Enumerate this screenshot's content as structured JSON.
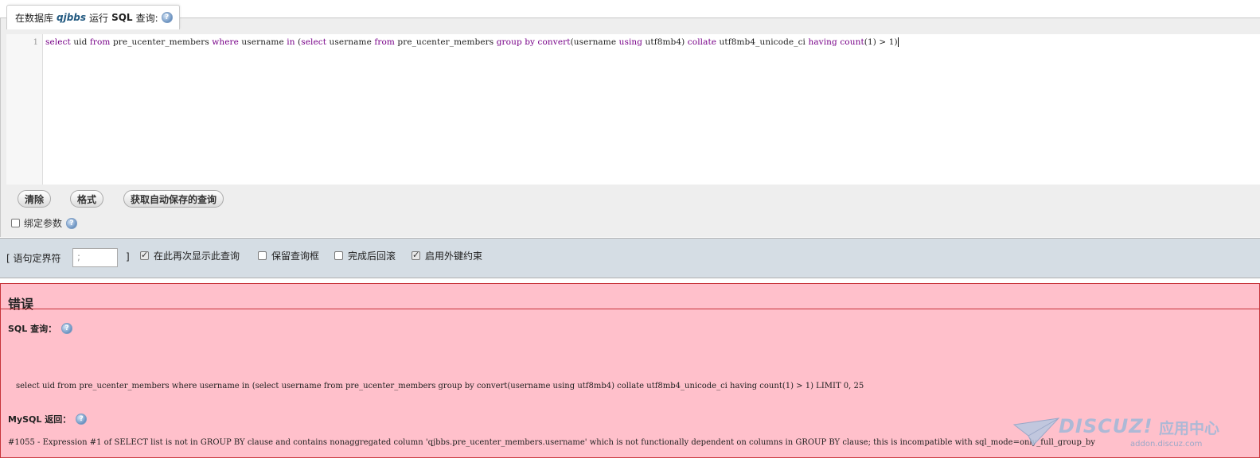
{
  "query_box": {
    "legend_prefix": "在数据库",
    "db_name": "qjbbs",
    "legend_run": "运行",
    "legend_sql": "SQL",
    "legend_suffix": "查询:",
    "help_glyph": "?",
    "line_number": "1",
    "code_tokens": [
      {
        "t": "select",
        "kw": true
      },
      {
        "t": " uid ",
        "kw": false
      },
      {
        "t": "from",
        "kw": true
      },
      {
        "t": " pre_ucenter_members ",
        "kw": false
      },
      {
        "t": "where",
        "kw": true
      },
      {
        "t": " username ",
        "kw": false
      },
      {
        "t": "in",
        "kw": true
      },
      {
        "t": " (",
        "kw": false
      },
      {
        "t": "select",
        "kw": true
      },
      {
        "t": " username ",
        "kw": false
      },
      {
        "t": "from",
        "kw": true
      },
      {
        "t": " pre_ucenter_members ",
        "kw": false
      },
      {
        "t": "group by",
        "kw": true
      },
      {
        "t": " ",
        "kw": false
      },
      {
        "t": "convert",
        "kw": true
      },
      {
        "t": "(username ",
        "kw": false
      },
      {
        "t": "using",
        "kw": true
      },
      {
        "t": " utf8mb4) ",
        "kw": false
      },
      {
        "t": "collate",
        "kw": true
      },
      {
        "t": " utf8mb4_unicode_ci ",
        "kw": false
      },
      {
        "t": "having",
        "kw": true
      },
      {
        "t": " ",
        "kw": false
      },
      {
        "t": "count",
        "kw": true
      },
      {
        "t": "(1) > 1)",
        "kw": false
      }
    ],
    "buttons": {
      "clear": "清除",
      "format": "格式",
      "get_autosaved": "获取自动保存的查询"
    },
    "bind_params_label": "绑定参数"
  },
  "options": {
    "delimiter_label": "[ 语句定界符",
    "delimiter_value": ";",
    "delimiter_close": "]",
    "show_again_label": "在此再次显示此查询",
    "show_again_checked": true,
    "retain_box_label": "保留查询框",
    "retain_box_checked": false,
    "rollback_label": "完成后回滚",
    "rollback_checked": false,
    "fk_label": "启用外键约束",
    "fk_checked": true
  },
  "error": {
    "title": "错误",
    "sql_label": "SQL 查询：",
    "query_text": "select uid from pre_ucenter_members where username in (select username from pre_ucenter_members group by convert(username using utf8mb4) collate utf8mb4_unicode_ci having count(1) > 1) LIMIT 0, 25",
    "mysql_label": "MySQL 返回：",
    "message": "#1055 - Expression #1 of SELECT list is not in GROUP BY clause and contains nonaggregated column 'qjbbs.pre_ucenter_members.username' which is not functionally dependent on columns in GROUP BY clause; this is incompatible with sql_mode=only_full_group_by"
  },
  "watermark": {
    "brand": "DISCUZ!",
    "cn": "应用中心",
    "url": "addon.discuz.com"
  },
  "colors": {
    "error_bg": "#ffc0cb",
    "error_border": "#c7343a",
    "keyword": "#770088",
    "db_name": "#235a81",
    "options_bg": "#d5dde4"
  }
}
